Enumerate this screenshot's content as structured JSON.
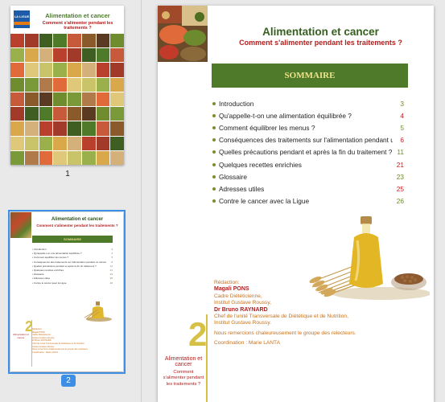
{
  "sidebar": {
    "page1_number": "1",
    "page2_number": "2",
    "cover": {
      "logo_text": "LA LIGUE",
      "title": "Alimentation et cancer",
      "subtitle": "Comment s'alimenter pendant les traitements ?"
    },
    "mini": {
      "title": "Alimentation et cancer",
      "subtitle": "Comment s'alimenter pendant les traitements ?",
      "sommaire": "SOMMAIRE",
      "two": "2"
    }
  },
  "page": {
    "title": "Alimentation et cancer",
    "subtitle": "Comment s'alimenter pendant les traitements ?",
    "sommaire": "SOMMAIRE",
    "toc": [
      {
        "label": "Introduction",
        "page": "3",
        "color": "green"
      },
      {
        "label": "Qu'appelle-t-on une alimentation équilibrée ?",
        "page": "4",
        "color": "red"
      },
      {
        "label": "Comment équilibrer les menus ?",
        "page": "5",
        "color": "green"
      },
      {
        "label": "Conséquences des traitements sur l'alimentation pendant un cancer",
        "page": "6",
        "color": "red"
      },
      {
        "label": "Quelles précautions pendant et après la fin du traitement ?",
        "page": "11",
        "color": "green"
      },
      {
        "label": "Quelques recettes enrichies",
        "page": "21",
        "color": "red"
      },
      {
        "label": "Glossaire",
        "page": "23",
        "color": "green"
      },
      {
        "label": "Adresses utiles",
        "page": "25",
        "color": "red"
      },
      {
        "label": "Contre le cancer avec la Ligue",
        "page": "26",
        "color": "green"
      }
    ],
    "redaction": {
      "heading": "Rédaction:",
      "author1_name": "Magali PONS",
      "author1_role": "Cadre Diététicienne,",
      "author1_org": "Institut Gustave Roussy,",
      "author2_name": "Dr Bruno RAYNARD",
      "author2_role": "Chef de l'unité Transversale de Diététique et de Nutrition,",
      "author2_org": "Institut Gustave Roussy.",
      "thanks": "Nous remercions chaleureusement le groupe des relecteurs.",
      "coordination": "Coordination : Marie LANTA"
    },
    "big_number": "2",
    "side_title": "Alimentation et cancer",
    "side_subtitle": "Comment s'alimenter pendant les traitements ?"
  },
  "colors": {
    "green_title": "#36601f",
    "red_subtitle": "#b41e1e",
    "sommaire_bar": "#4e7a2a",
    "sommaire_text": "#efe28c",
    "orange_text": "#c8711a",
    "selection_blue": "#3d8fe6"
  }
}
